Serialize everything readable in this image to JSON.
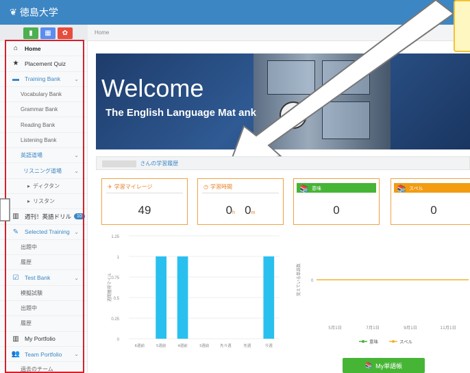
{
  "app": {
    "brand": "徳島大学"
  },
  "breadcrumb": "Home",
  "sidebar": {
    "items": [
      {
        "label": "Home",
        "icon": "home-icon"
      },
      {
        "label": "Placement Quiz",
        "icon": "star-icon"
      },
      {
        "label": "Training Bank",
        "icon": "book-icon"
      },
      {
        "label": "Vocabulary Bank"
      },
      {
        "label": "Grammar Bank"
      },
      {
        "label": "Reading Bank"
      },
      {
        "label": "Listening Bank"
      },
      {
        "label": "英語道場"
      },
      {
        "label": "リスニング道場"
      },
      {
        "label": "ディクタン"
      },
      {
        "label": "リスタン"
      },
      {
        "label": "週刊！英語ドリル",
        "badge": "10",
        "icon": "chart-icon"
      },
      {
        "label": "Selected Training",
        "icon": "pencil-icon"
      },
      {
        "label": "出題中"
      },
      {
        "label": "履歴"
      },
      {
        "label": "Test Bank",
        "icon": "checkbox-icon"
      },
      {
        "label": "模擬試験"
      },
      {
        "label": "出題中"
      },
      {
        "label": "履歴"
      },
      {
        "label": "My Portfolio",
        "icon": "chart-icon"
      },
      {
        "label": "Team Portfolio",
        "icon": "team-icon"
      },
      {
        "label": "過去のチーム"
      }
    ]
  },
  "banner": {
    "welcome": "Welcome",
    "subtitle": "The English Language Mat             ank"
  },
  "section": {
    "title": "さんの学習履歴"
  },
  "cards": [
    {
      "label": "学習マイレージ",
      "value": "49"
    },
    {
      "label": "学習時間",
      "hours": "0",
      "hours_unit": "h",
      "minutes": "0",
      "minutes_unit": "m"
    },
    {
      "label": "意味",
      "value": "0"
    },
    {
      "label": "スペル",
      "value": "0"
    }
  ],
  "chart_data": [
    {
      "type": "bar",
      "ylabel": "週間獲得マイル",
      "ylim": [
        0,
        1.25
      ],
      "yticks": [
        "0",
        "0.25",
        "0.5",
        "0.75",
        "1",
        "1.25"
      ],
      "categories": [
        "6週前",
        "5週前",
        "4週前",
        "3週前",
        "先々週",
        "先週",
        "今週"
      ],
      "values": [
        0,
        1,
        1,
        0,
        0,
        0,
        1
      ],
      "color": "#29c0f0"
    },
    {
      "type": "line",
      "ylabel": "覚えている単語数",
      "yticks": [
        "0"
      ],
      "categories": [
        "5月1日",
        "7月1日",
        "9月1日",
        "11月1日"
      ],
      "series": [
        {
          "name": "意味",
          "values": [
            0,
            0,
            0,
            0
          ],
          "color": "#46b535"
        },
        {
          "name": "スペル",
          "values": [
            0,
            0,
            0,
            0
          ],
          "color": "#f0b429"
        }
      ]
    }
  ],
  "my_button": {
    "label": "My単語帳"
  }
}
